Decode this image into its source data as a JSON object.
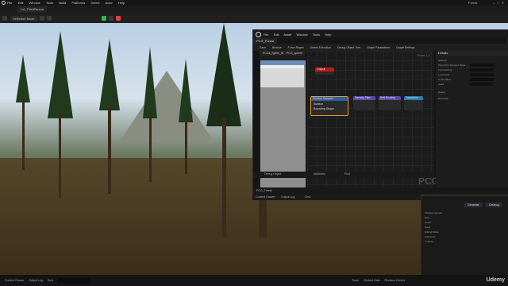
{
  "editor": {
    "menu": [
      "File",
      "Edit",
      "Window",
      "Tools",
      "Build",
      "Platforms",
      "Select",
      "Actor",
      "Help"
    ],
    "level_tab": "Lvl_ThirdPerson",
    "project_name": "Forest",
    "selection_mode": "Selection Mode"
  },
  "pcg_window": {
    "title_tab": "PCG_Forest",
    "menu": [
      "File",
      "Edit",
      "Asset",
      "Window",
      "Tools",
      "Help"
    ],
    "toolbar": [
      "Save",
      "Browse",
      "Force Regen",
      "Select Execution",
      "Debug Object Tree",
      "Graph Parameters",
      "Graph Settings"
    ],
    "left_tabs": [
      "PCGs_Spline_W",
      "PCG_sphere"
    ],
    "graph_zoom": "Zoom 1:1",
    "graph_watermark": "PCG Graph",
    "nodes": {
      "output": "Output",
      "surface_sampler": "Surface Sampler",
      "surface_pin": "Surface",
      "bounding_pin": "Bounding Shape",
      "density_filter": "Density Filter",
      "self_pruning": "Self Pruning",
      "transform": "Transform"
    },
    "bottom_tabs": [
      "Debug Object",
      "Attributes",
      "Find"
    ],
    "status_tab": "PCG_Forest",
    "details_title": "Details",
    "details_rows": [
      "Settings",
      "Points Per Squared Meter",
      "Point Extents",
      "Looseness",
      "Unbounded",
      "Seed",
      "Debug",
      "Execution"
    ]
  },
  "lower_panel": {
    "rows": [
      "PCGComponent",
      "PCG",
      "Graph",
      "Seed",
      "Editing Mode",
      "Advanced",
      "Collision"
    ],
    "generate_button": "Generate",
    "cleanup_button": "Cleanup"
  },
  "statusbar": {
    "items": [
      "Content Drawer",
      "Output Log",
      "Cmd",
      "Trace",
      "Derived Data",
      "Revision Control"
    ],
    "watermark": "Udemy"
  }
}
